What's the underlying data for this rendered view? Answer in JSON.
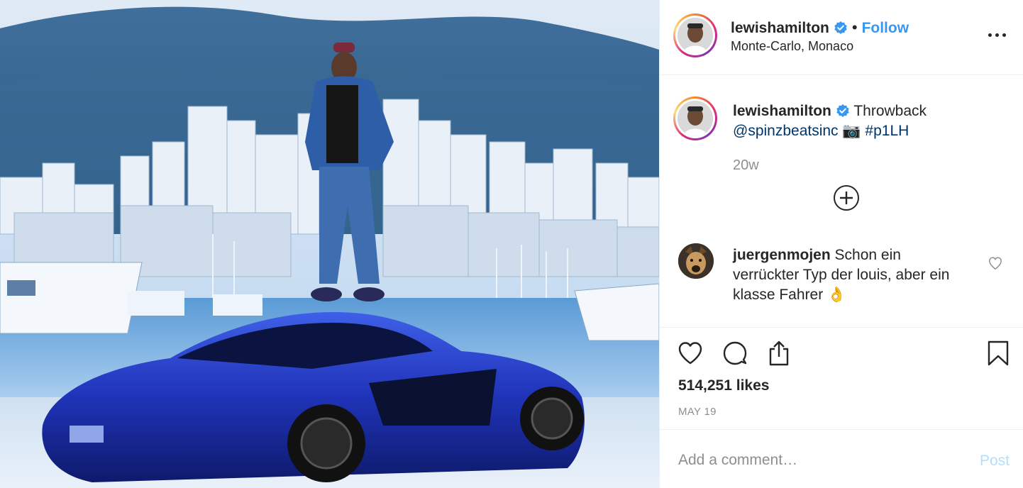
{
  "post": {
    "image_alt": "Man in denim jacket standing on top of a blue sports car in front of Monaco harbour and city"
  },
  "header": {
    "username": "lewishamilton",
    "verified": true,
    "separator": "•",
    "follow_label": "Follow",
    "location": "Monte-Carlo, Monaco",
    "more_icon": "more-options-icon"
  },
  "caption": {
    "username": "lewishamilton",
    "text": "Throwback",
    "mention": "@spinzbeatsinc",
    "emoji": "📷",
    "hashtag": "#p1LH",
    "time_ago": "20w"
  },
  "comments": [
    {
      "username": "juergenmojen",
      "text": "Schon ein verrückter Typ der louis, aber ein klasse Fahrer",
      "emoji": "👌"
    }
  ],
  "actions": {
    "likes": "514,251 likes",
    "date": "MAY 19"
  },
  "comment_box": {
    "placeholder": "Add a comment…",
    "post_label": "Post"
  },
  "colors": {
    "link": "#003569",
    "follow": "#3897f0",
    "verified": "#3897f0",
    "post_disabled": "#b2dffc",
    "muted": "#8e8e8e"
  }
}
